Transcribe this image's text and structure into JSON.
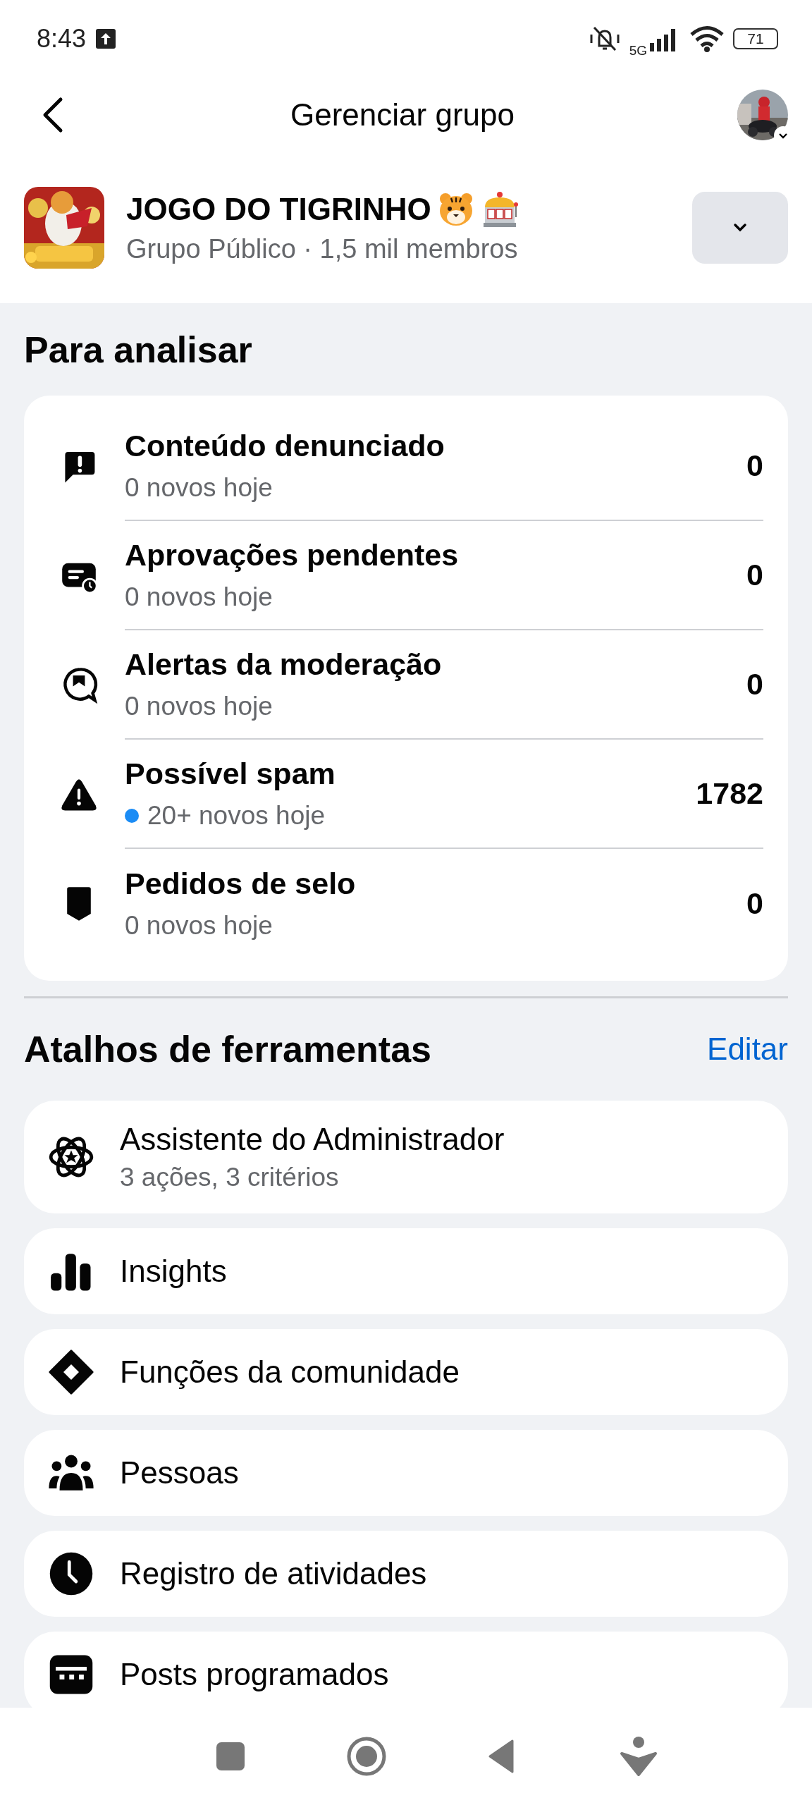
{
  "status_bar": {
    "time": "8:43",
    "network": "5G",
    "battery": "71"
  },
  "header": {
    "title": "Gerenciar grupo"
  },
  "group": {
    "name": "JOGO DO TIGRINHO",
    "subtitle": "Grupo Público · 1,5 mil membros"
  },
  "review": {
    "title": "Para analisar",
    "items": [
      {
        "kind": "report",
        "title": "Conteúdo denunciado",
        "subtitle": "0 novos hoje",
        "count": "0",
        "new": false
      },
      {
        "kind": "pending",
        "title": "Aprovações pendentes",
        "subtitle": "0 novos hoje",
        "count": "0",
        "new": false
      },
      {
        "kind": "alert",
        "title": "Alertas da moderação",
        "subtitle": "0 novos hoje",
        "count": "0",
        "new": false
      },
      {
        "kind": "spam",
        "title": "Possível spam",
        "subtitle": "20+ novos hoje",
        "count": "1782",
        "new": true
      },
      {
        "kind": "badge",
        "title": "Pedidos de selo",
        "subtitle": "0 novos hoje",
        "count": "0",
        "new": false
      }
    ]
  },
  "shortcuts": {
    "title": "Atalhos de ferramentas",
    "edit": "Editar",
    "items": [
      {
        "kind": "assistant",
        "title": "Assistente do Administrador",
        "subtitle": "3 ações, 3 critérios"
      },
      {
        "kind": "insights",
        "title": "Insights"
      },
      {
        "kind": "roles",
        "title": "Funções da comunidade"
      },
      {
        "kind": "people",
        "title": "Pessoas"
      },
      {
        "kind": "activity",
        "title": "Registro de atividades"
      },
      {
        "kind": "scheduled",
        "title": "Posts programados"
      }
    ]
  }
}
